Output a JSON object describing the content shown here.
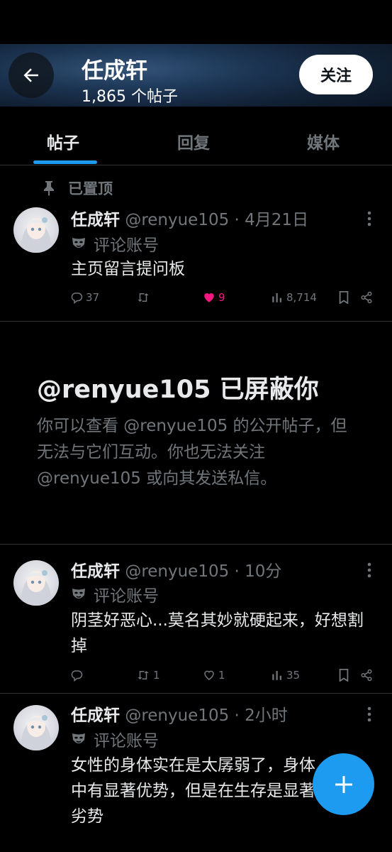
{
  "header": {
    "name": "任成轩",
    "post_count": "1,865 个帖子",
    "follow_label": "关注"
  },
  "tabs": [
    {
      "label": "帖子",
      "active": true
    },
    {
      "label": "回复",
      "active": false
    },
    {
      "label": "媒体",
      "active": false
    }
  ],
  "pinned": {
    "label": "已置顶",
    "tweet": {
      "name": "任成轩",
      "meta": "@renyue105 · 4月21日",
      "label": "评论账号",
      "text": "主页留言提问板",
      "replies": "37",
      "retweets": "",
      "likes": "9",
      "liked": true,
      "views": "8,714"
    }
  },
  "blocked": {
    "title": "@renyue105 已屏蔽你",
    "description": "你可以查看 @renyue105 的公开帖子，但无法与它们互动。你也无法关注 @renyue105 或向其发送私信。"
  },
  "tweets": [
    {
      "name": "任成轩",
      "meta": "@renyue105 · 10分",
      "label": "评论账号",
      "text": "阴茎好恶心...莫名其妙就硬起来，好想割掉",
      "replies": "",
      "retweets": "1",
      "likes": "1",
      "views": "35"
    },
    {
      "name": "任成轩",
      "meta": "@renyue105 · 2小时",
      "label": "评论账号",
      "text": "女性的身体实在是太孱弱了，身体中有显著优势，但是在生存是显著劣势"
    }
  ],
  "colors": {
    "accent": "#1d9bf0",
    "like": "#f91880",
    "muted": "#71767b",
    "text": "#e7e9ea",
    "background": "#000000"
  },
  "icons": [
    "back-arrow-icon",
    "pin-icon",
    "mask-icon",
    "more-icon",
    "reply-icon",
    "retweet-icon",
    "heart-icon",
    "views-icon",
    "bookmark-icon",
    "share-icon",
    "plus-icon"
  ]
}
